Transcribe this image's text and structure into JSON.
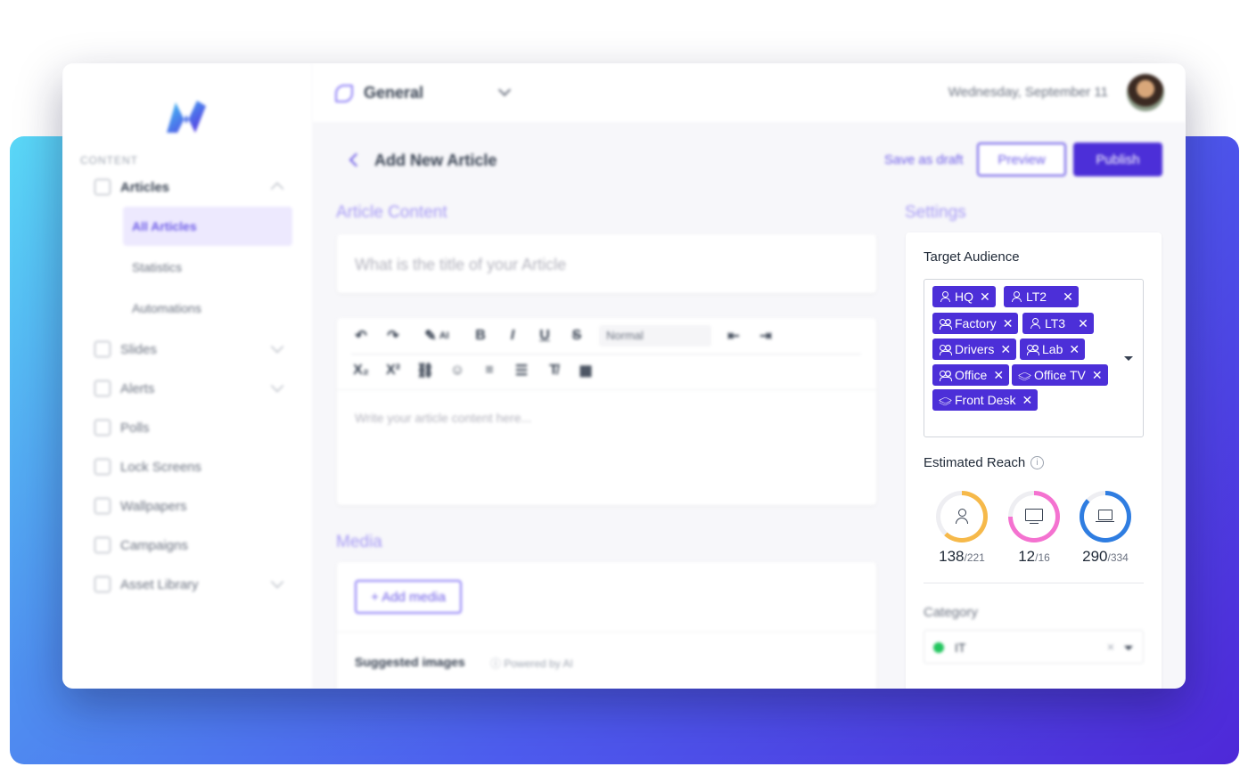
{
  "colors": {
    "accent": "#4c2fd8",
    "accent_light": "#6d5ce7",
    "ring_users": "#f6b94a",
    "ring_screens": "#f472d0",
    "ring_devices": "#2f7de1",
    "category_dot": "#22c55e"
  },
  "sidebar": {
    "section_label": "CONTENT",
    "articles_label": "Articles",
    "sub_items": [
      "All Articles",
      "Statistics",
      "Automations"
    ],
    "items": [
      "Slides",
      "Alerts",
      "Polls",
      "Lock Screens",
      "Wallpapers",
      "Campaigns",
      "Asset Library"
    ]
  },
  "header": {
    "workspace": "General",
    "date": "Wednesday, September 11"
  },
  "page": {
    "title": "Add New Article",
    "save_draft": "Save as draft",
    "preview": "Preview",
    "publish": "Publish",
    "content_heading": "Article Content",
    "title_placeholder": "What is the title of your Article",
    "editor_placeholder": "Write your article content here...",
    "format_value": "Normal",
    "ai_label": "AI",
    "media_heading": "Media",
    "add_media": "+ Add media",
    "suggested": "Suggested images",
    "powered": "Powered by AI",
    "settings_heading": "Settings"
  },
  "settings": {
    "target_audience_label": "Target Audience",
    "chips": [
      {
        "label": "HQ",
        "icon": "user-icon"
      },
      {
        "label": "LT2",
        "icon": "user-icon"
      },
      {
        "label": "Factory",
        "icon": "group-icon"
      },
      {
        "label": "LT3",
        "icon": "user-icon"
      },
      {
        "label": "Drivers",
        "icon": "group-icon"
      },
      {
        "label": "Lab",
        "icon": "group-icon"
      },
      {
        "label": "Office",
        "icon": "group-icon"
      },
      {
        "label": "Office TV",
        "icon": "layers-icon"
      },
      {
        "label": "Front Desk",
        "icon": "layers-icon"
      }
    ],
    "estimated_reach_label": "Estimated Reach",
    "reach": [
      {
        "value": "138",
        "total": "/221",
        "fraction": 0.62
      },
      {
        "value": "12",
        "total": "/16",
        "fraction": 0.75
      },
      {
        "value": "290",
        "total": "/334",
        "fraction": 0.87
      }
    ],
    "category_label": "Category",
    "category_value": "IT"
  }
}
